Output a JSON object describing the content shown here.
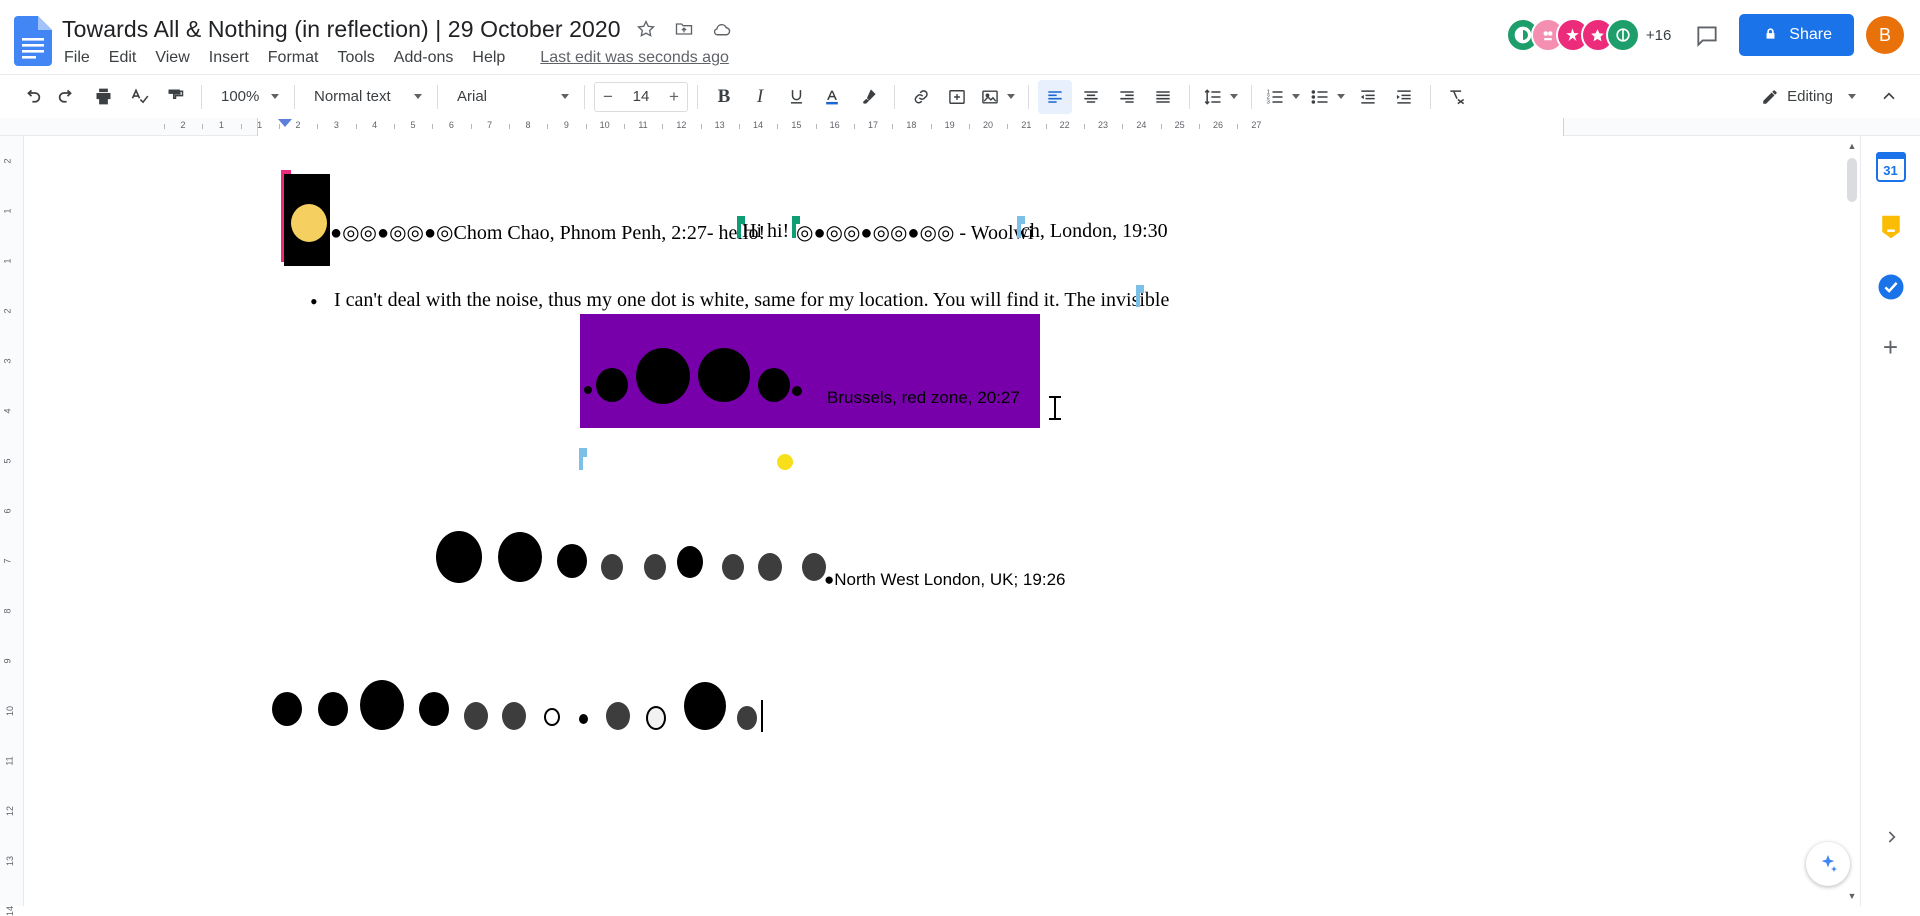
{
  "app": {
    "doc_title": "Towards All & Nothing (in reflection) | 29 October 2020",
    "star_icon": "star-icon",
    "move_icon": "move-to-folder-icon",
    "cloud_icon": "cloud-saved-icon",
    "last_edit": "Last edit was seconds ago",
    "menus": [
      "File",
      "Edit",
      "View",
      "Insert",
      "Format",
      "Tools",
      "Add-ons",
      "Help"
    ],
    "share_label": "Share",
    "share_color": "#1a73e8",
    "comment_icon": "comment-history-icon",
    "account_initial": "B",
    "account_color": "#e8710a",
    "collaborators_overflow": "+16",
    "avatars": [
      {
        "name": "collaborator-1",
        "color": "#1e9e6a",
        "glyph": "◑"
      },
      {
        "name": "collaborator-2",
        "color": "#f48fb1",
        "glyph": "◔"
      },
      {
        "name": "collaborator-3",
        "color": "#ec2b7b",
        "glyph": "✶"
      },
      {
        "name": "collaborator-4",
        "color": "#ec2b7b",
        "glyph": "✵"
      },
      {
        "name": "collaborator-5",
        "color": "#1e9e6a",
        "glyph": "◯"
      }
    ]
  },
  "toolbar": {
    "undo": "undo-icon",
    "redo": "redo-icon",
    "print": "print-icon",
    "spellcheck": "spellcheck-icon",
    "paint_format": "paint-format-icon",
    "zoom_value": "100%",
    "style_value": "Normal text",
    "font_value": "Arial",
    "font_size_value": "14",
    "decrease_font": "−",
    "increase_font": "+",
    "bold": "B",
    "italic": "I",
    "underline": "U",
    "text_color": "A",
    "highlight": "highlight-icon",
    "insert_link": "link-icon",
    "add_comment": "add-comment-icon",
    "insert_image": "insert-image-icon",
    "align_left": "align-left-icon",
    "align_center": "align-center-icon",
    "align_right": "align-right-icon",
    "align_justify": "align-justify-icon",
    "line_spacing": "line-spacing-icon",
    "numbered_list": "numbered-list-icon",
    "bulleted_list": "bulleted-list-icon",
    "decrease_indent": "decrease-indent-icon",
    "increase_indent": "increase-indent-icon",
    "clear_formatting": "clear-formatting-icon",
    "mode_label": "Editing",
    "mode_icon": "pencil-icon",
    "hide_menus": "collapse-toolbar-icon"
  },
  "ruler": {
    "numbers": [
      "2",
      "1",
      "1",
      "2",
      "3",
      "4",
      "5",
      "6",
      "7",
      "8",
      "9",
      "10",
      "11",
      "12",
      "13",
      "14",
      "15",
      "16",
      "17",
      "18",
      "19",
      "20",
      "21",
      "22",
      "23",
      "24",
      "25",
      "26",
      "27"
    ],
    "left_vnumbers": [
      "2",
      "1",
      "1",
      "2",
      "3",
      "4",
      "5",
      "6",
      "7",
      "8",
      "9",
      "10",
      "11",
      "12",
      "13",
      "14"
    ]
  },
  "document": {
    "line1_text": "●◎◎●◎◎●◎Chom Chao, Phnom Penh, 2:27- hello!",
    "line1_text_b": "Hi hi! ",
    "line1_text_c": "◎●◎◎●◎◎●◎◎ - Woolwi",
    "line1_text_d": "ch, London, 19:30",
    "bullet_glyph": "•",
    "bullet_text": "I can't deal with the noise, thus my one dot is white, same for my location. You will find it. The invisible",
    "brussels_text": "Brussels, red zone, 20:27",
    "nwlondon_text": "●North West London, UK; 19:26",
    "purple_color": "#7800aa",
    "black_box_color": "#000000",
    "yellow_ellipse_color": "#f5cf5f",
    "pink_cursor_color": "#ec2b7b",
    "teal_cursor_color": "#0f9d74",
    "blue_cursor_color": "#7cc0e8",
    "yellow_dot_color": "#f7e019",
    "row_nwl_circles": [
      {
        "size": 46,
        "color": "#000000"
      },
      {
        "size": 44,
        "color": "#000000"
      },
      {
        "size": 30,
        "color": "#000000"
      },
      {
        "size": 22,
        "color": "#3d3d3d"
      },
      {
        "size": 22,
        "color": "#3d3d3d"
      },
      {
        "size": 26,
        "color": "#000000"
      },
      {
        "size": 22,
        "color": "#3d3d3d"
      },
      {
        "size": 24,
        "color": "#3d3d3d"
      },
      {
        "size": 24,
        "color": "#3d3d3d"
      }
    ],
    "row_bottom_circles": [
      {
        "size": 30,
        "color": "#000000"
      },
      {
        "size": 30,
        "color": "#000000"
      },
      {
        "size": 44,
        "color": "#000000"
      },
      {
        "size": 30,
        "color": "#000000"
      },
      {
        "size": 24,
        "color": "#3d3d3d"
      },
      {
        "size": 24,
        "color": "#3d3d3d"
      },
      {
        "size": 16,
        "color": "#ffffff"
      },
      {
        "size": 9,
        "color": "#000000"
      },
      {
        "size": 24,
        "color": "#3d3d3d"
      },
      {
        "size": 20,
        "color": "#f2f2f2"
      },
      {
        "size": 42,
        "color": "#000000"
      },
      {
        "size": 20,
        "color": "#3d3d3d"
      }
    ],
    "purple_box_circles": [
      {
        "size": 8,
        "color": "#000000"
      },
      {
        "size": 32,
        "color": "#000000"
      },
      {
        "size": 54,
        "color": "#000000"
      },
      {
        "size": 52,
        "color": "#000000"
      },
      {
        "size": 32,
        "color": "#000000"
      },
      {
        "size": 10,
        "color": "#000000"
      }
    ]
  },
  "rightrail": {
    "calendar_label": "31",
    "calendar_icon": "calendar-icon",
    "keep_icon": "keep-icon",
    "tasks_icon": "tasks-icon",
    "add_icon": "add-sidebar-icon",
    "expand_icon": "expand-panel-icon",
    "explore_icon": "explore-icon"
  }
}
